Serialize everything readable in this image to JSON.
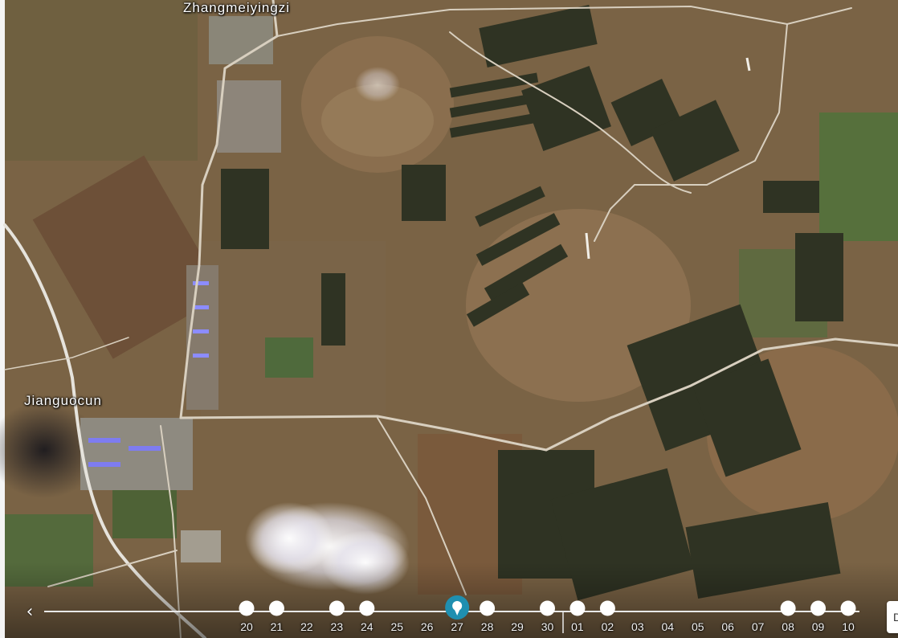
{
  "map": {
    "labels": {
      "north_village": "Zhangmeiyingzi",
      "west_village": "Jianguocun"
    }
  },
  "timeline": {
    "prev_icon": "chevron-left-icon",
    "ticks": [
      {
        "label": "20",
        "has_image": true,
        "selected": false
      },
      {
        "label": "21",
        "has_image": true,
        "selected": false
      },
      {
        "label": "22",
        "has_image": false,
        "selected": false
      },
      {
        "label": "23",
        "has_image": true,
        "selected": false
      },
      {
        "label": "24",
        "has_image": true,
        "selected": false
      },
      {
        "label": "25",
        "has_image": false,
        "selected": false
      },
      {
        "label": "26",
        "has_image": false,
        "selected": false
      },
      {
        "label": "27",
        "has_image": true,
        "selected": true
      },
      {
        "label": "28",
        "has_image": true,
        "selected": false
      },
      {
        "label": "29",
        "has_image": false,
        "selected": false
      },
      {
        "label": "30",
        "has_image": true,
        "selected": false
      },
      {
        "label": "01",
        "has_image": true,
        "selected": false
      },
      {
        "label": "02",
        "has_image": true,
        "selected": false
      },
      {
        "label": "03",
        "has_image": false,
        "selected": false
      },
      {
        "label": "04",
        "has_image": false,
        "selected": false
      },
      {
        "label": "05",
        "has_image": false,
        "selected": false
      },
      {
        "label": "06",
        "has_image": false,
        "selected": false
      },
      {
        "label": "07",
        "has_image": false,
        "selected": false
      },
      {
        "label": "08",
        "has_image": true,
        "selected": false
      },
      {
        "label": "09",
        "has_image": true,
        "selected": false
      },
      {
        "label": "10",
        "has_image": true,
        "selected": false
      }
    ],
    "selected_color": "#1f8fb0"
  },
  "edge_button": {
    "label": "D"
  }
}
